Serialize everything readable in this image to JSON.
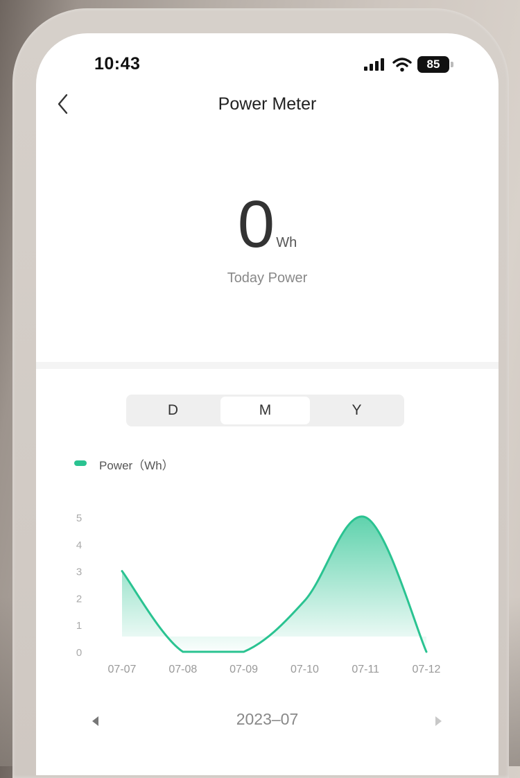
{
  "status_bar": {
    "time": "10:43",
    "battery": "85"
  },
  "header": {
    "title": "Power Meter",
    "back_icon": "chevron-left-icon"
  },
  "today": {
    "value": "0",
    "unit": "Wh",
    "caption": "Today Power"
  },
  "period_tabs": [
    {
      "label": "D",
      "active": false
    },
    {
      "label": "M",
      "active": true
    },
    {
      "label": "Y",
      "active": false
    }
  ],
  "legend": {
    "label": "Power（Wh）",
    "color": "#2ac391"
  },
  "chart_data": {
    "type": "area",
    "categories": [
      "07-07",
      "07-08",
      "07-09",
      "07-10",
      "07-11",
      "07-12"
    ],
    "series": [
      {
        "name": "Power（Wh）",
        "values": [
          3,
          0,
          0,
          1.9,
          5,
          0
        ]
      }
    ],
    "yticks": [
      0,
      1,
      2,
      3,
      4,
      5
    ],
    "ylim": [
      0,
      5
    ],
    "grid": false,
    "legend_position": "top-left",
    "line_color": "#2ac391"
  },
  "month_nav": {
    "label": "2023–07",
    "prev_icon": "caret-left-icon",
    "next_icon": "caret-right-icon"
  }
}
